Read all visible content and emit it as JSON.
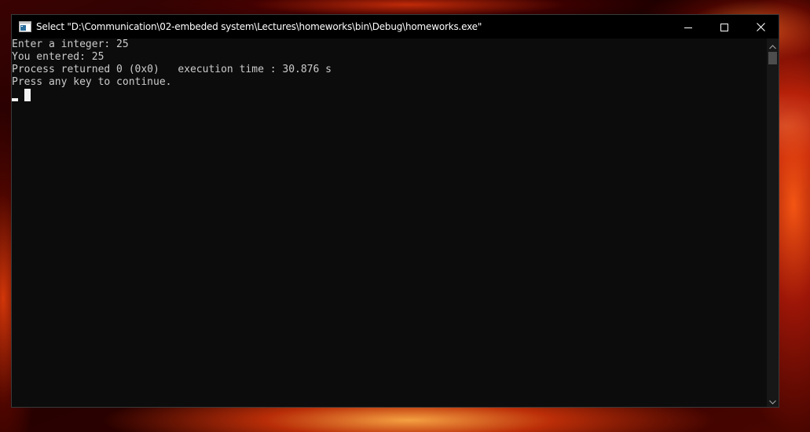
{
  "window": {
    "title": "Select \"D:\\Communication\\02-embeded system\\Lectures\\homeworks\\bin\\Debug\\homeworks.exe\"",
    "icon": "console-app-icon",
    "controls": {
      "minimize_icon": "minimize-icon",
      "maximize_icon": "maximize-icon",
      "close_icon": "close-icon"
    }
  },
  "console": {
    "lines": [
      "Enter a integer: 25",
      "You entered: 25",
      "Process returned 0 (0x0)   execution time : 30.876 s",
      "Press any key to continue."
    ],
    "text_color": "#cccccc",
    "background_color": "#0c0c0c"
  },
  "scrollbar": {
    "up_icon": "scroll-up-arrow-icon",
    "down_icon": "scroll-down-arrow-icon"
  }
}
